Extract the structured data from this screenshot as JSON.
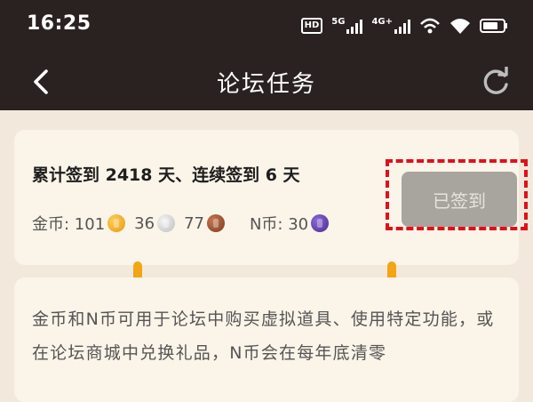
{
  "status_bar": {
    "time": "16:25",
    "hd_label": "HD",
    "net1_label": "5G",
    "net2_label": "4G+"
  },
  "nav": {
    "title": "论坛任务",
    "back_icon": "chevron-left-icon",
    "refresh_icon": "refresh-icon"
  },
  "signin": {
    "summary": "累计签到 2418 天、连续签到 6 天",
    "gold_label": "金币: 101",
    "silver_value": "36",
    "bronze_value": "77",
    "n_label": "N币: 30",
    "signed_label": "已签到"
  },
  "info": {
    "text": "金币和N币可用于论坛中购买虚拟道具、使用特定功能，或在论坛商城中兑换礼品，N币会在每年底清零"
  },
  "colors": {
    "header_bg": "#2a2221",
    "page_bg": "#f2e9dc",
    "card_bg": "#fbf4e9",
    "accent": "#f2a515",
    "highlight": "#e0101a"
  }
}
